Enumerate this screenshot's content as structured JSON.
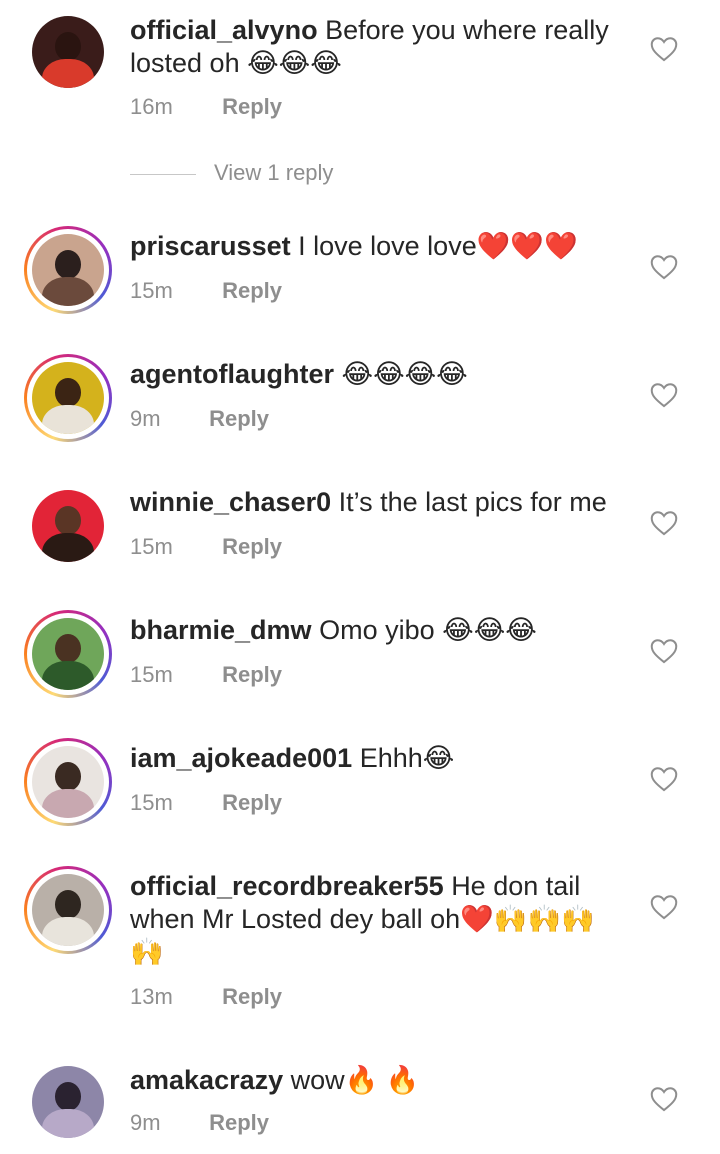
{
  "reply_label": "Reply",
  "view_replies": "View 1 reply",
  "comments": [
    {
      "username": "official_alvyno",
      "text": "Before you where really losted oh",
      "emoji": "😂😂😂",
      "time": "16m",
      "avatar_colors": [
        "#3a1c1a",
        "#d93a2b",
        "#1b1b1b"
      ]
    },
    {
      "username": "priscarusset",
      "text": "I love love love",
      "emoji": "❤️❤️❤️",
      "time": "15m",
      "avatar_colors": [
        "#c9a48e",
        "#2b1f1d",
        "#6b4a3c"
      ]
    },
    {
      "username": "agentoflaughter",
      "text": "",
      "emoji": "😂😂😂😂",
      "time": "9m",
      "avatar_colors": [
        "#d4b21c",
        "#3b2414",
        "#e9e3d8"
      ]
    },
    {
      "username": "winnie_chaser0",
      "text": "It’s the last pics for me",
      "emoji": "",
      "time": "15m",
      "avatar_colors": [
        "#e22437",
        "#5a3525",
        "#2a1a14"
      ]
    },
    {
      "username": "bharmie_dmw",
      "text": "Omo yibo",
      "emoji": "😂😂😂",
      "time": "15m",
      "avatar_colors": [
        "#6fa65a",
        "#4a3222",
        "#2d5a2a"
      ]
    },
    {
      "username": "iam_ajokeade001",
      "text": "Ehhh",
      "emoji": "😂",
      "time": "15m",
      "avatar_colors": [
        "#e9e4e0",
        "#3a2a22",
        "#c8a8b0"
      ]
    },
    {
      "username": "official_recordbreaker55",
      "text": "He don tail when Mr Losted dey ball oh",
      "emoji": "❤️🙌🙌🙌🙌",
      "time": "13m",
      "avatar_colors": [
        "#b9b0a8",
        "#2e2620",
        "#e8e4dc"
      ]
    },
    {
      "username": "amakacrazy",
      "text": "wow",
      "emoji": "🔥 🔥",
      "time": "9m",
      "avatar_colors": [
        "#8d86a8",
        "#2a2230",
        "#b7a9c8"
      ]
    }
  ]
}
